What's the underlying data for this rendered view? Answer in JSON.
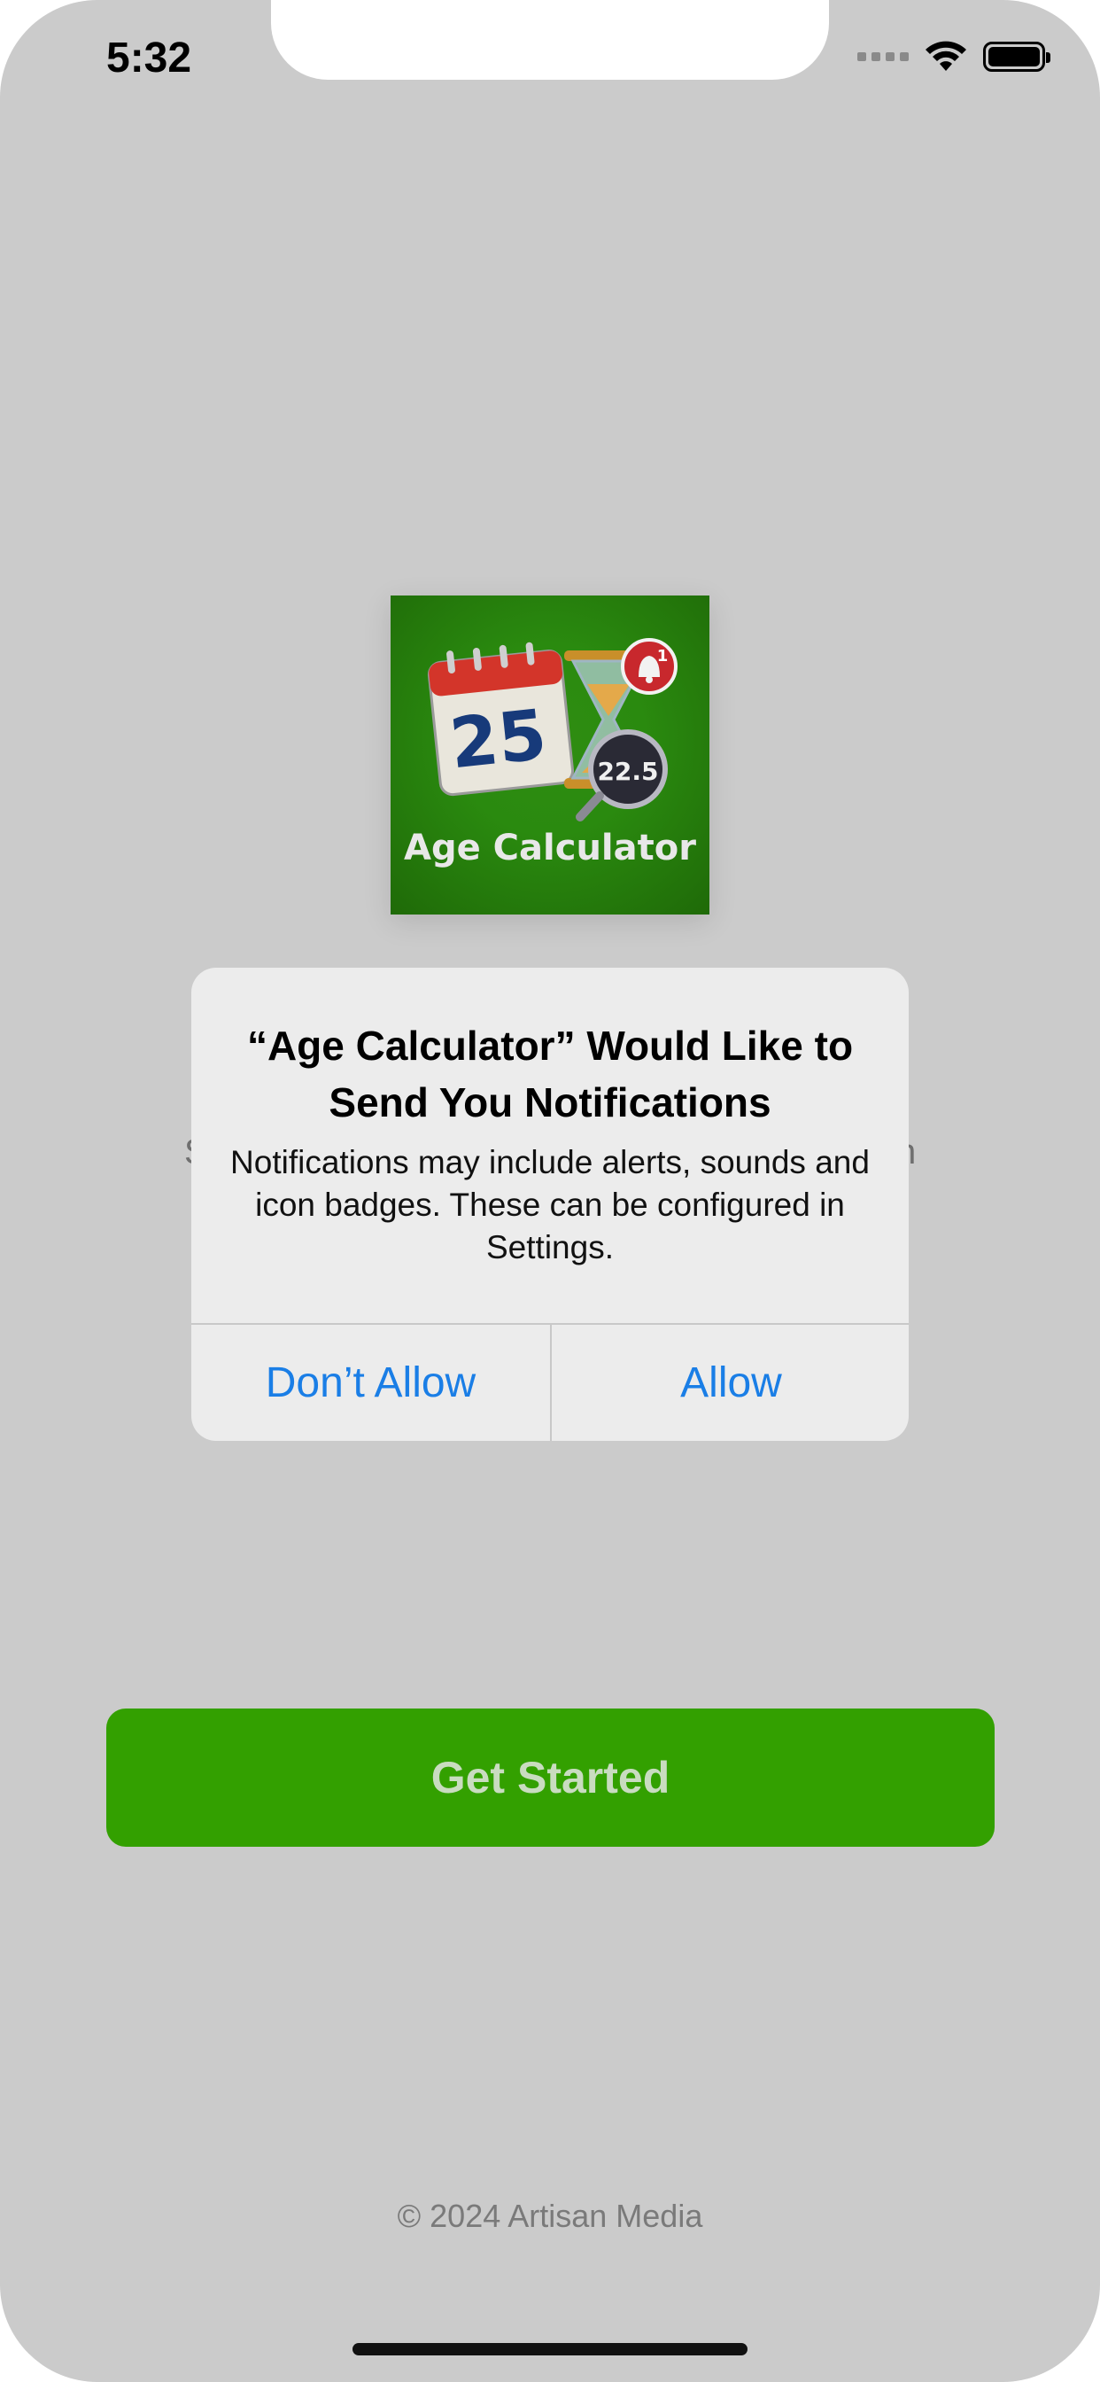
{
  "status_bar": {
    "time": "5:32"
  },
  "app_icon": {
    "icon": "age-calculator-app-icon",
    "calendar_day": "25",
    "gauge_value": "22.5",
    "badge_count": "1",
    "caption": "Age Calculator"
  },
  "background_text": {
    "left_fragment": "S",
    "right_fragment": "n"
  },
  "alert": {
    "title": "“Age Calculator” Would Like to Send You Notifications",
    "message": "Notifications may include alerts, sounds and icon badges. These can be configured in Settings.",
    "deny_label": "Don’t Allow",
    "allow_label": "Allow"
  },
  "cta": {
    "label": "Get Started"
  },
  "footer": {
    "copyright": "© 2024 Artisan Media"
  },
  "colors": {
    "accent_green": "#33a000",
    "ios_blue": "#1a7ee6",
    "dim_background": "#cbcbcb"
  }
}
